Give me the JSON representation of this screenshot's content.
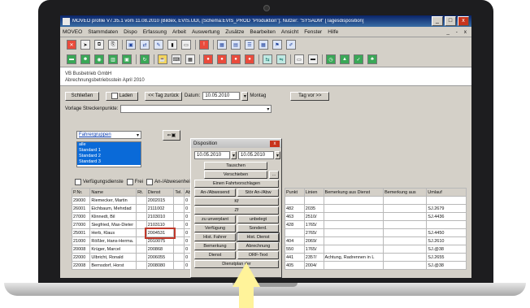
{
  "window": {
    "title": "MOVEO profile V7.35.1 vom 11.08.2010 (Bildex, EVIS.UDI, [Schema:EVIS_PROD \"Produktion\"]; Nutzer: \"SYSADM\" [Tagesdisposition]",
    "minimize": "_",
    "maximize": "□",
    "close": "x"
  },
  "menu": {
    "items": [
      "MOVEO",
      "Stammdaten",
      "Dispo",
      "Erfassung",
      "Arbeit",
      "Auswertung",
      "Zusätze",
      "Bearbeiten",
      "Ansicht",
      "Fenster",
      "Hilfe"
    ],
    "right_controls": "_ ‑ x"
  },
  "org": {
    "line1": "VB Busbetrieb GmbH",
    "line2": "Abrechnungsbetriebsstein April 2010"
  },
  "controls": {
    "close_btn": "Schließen",
    "load_btn": "Laden",
    "prev_day_btn": "<< Tag zurück",
    "date_label": "Datum:",
    "date_value": "10.05.2010",
    "weekday": "Montag",
    "next_day_btn": "Tag vor >>",
    "template_label": "Vorlage Streckenpunkte:"
  },
  "filter": {
    "dropdown": "Fahrergruppen",
    "options": [
      "alle",
      "Standard 1",
      "Standard 2",
      "Standard 3"
    ],
    "chk_verfuegung": "Verfügungsdienste",
    "chk_frei": "Frei",
    "chk_abwesend": "An-/Abwesenheit"
  },
  "table": {
    "headers": [
      "P.Nr.",
      "Name",
      "Rt.",
      "Dienst",
      "Tel.",
      "Ab"
    ],
    "rows": [
      [
        "29000",
        "Riemecker, Martin",
        "",
        "2002015",
        "",
        "0"
      ],
      [
        "26001",
        "Eichbaum, Mehrdad",
        "",
        "2111002",
        "",
        "0"
      ],
      [
        "27000",
        "Klinnedt, Bil",
        "",
        "2103010",
        "",
        "0"
      ],
      [
        "27000",
        "Siegfried, Max-Dieter",
        "",
        "2103110",
        "",
        "0"
      ],
      [
        "25001",
        "Herb, Klaus",
        "",
        "2004531",
        "",
        "0"
      ],
      [
        "21000",
        "Rößler, Hans-Herma.",
        "",
        "2010075",
        "",
        "0"
      ],
      [
        "20008",
        "Krüger, Marcel",
        "",
        "200868",
        "",
        "0"
      ],
      [
        "22000",
        "Ulbricht, Ronald",
        "",
        "2006055",
        "",
        "0"
      ],
      [
        "22008",
        "Bernsdorf, Horst",
        "",
        "2008080",
        "",
        "0"
      ]
    ]
  },
  "table_right": {
    "headers": [
      "Punkt",
      "Linien",
      "Bemerkung aus Dienst",
      "Bemerkung aus",
      "Umlauf"
    ],
    "rows": [
      [
        "",
        "",
        "",
        "",
        ""
      ],
      [
        "482",
        "2035",
        "",
        "",
        "SJ.2679"
      ],
      [
        "463",
        "2510/",
        "",
        "",
        "SJ.4436"
      ],
      [
        "428",
        "1765/",
        "",
        "",
        ""
      ],
      [
        "",
        "2765/",
        "",
        "",
        "SJ.4450"
      ],
      [
        "404",
        "2069/",
        "",
        "",
        "SJ.2610"
      ],
      [
        "550",
        "1765/",
        "",
        "",
        "SJ.@38"
      ],
      [
        "441",
        "2357/",
        "Achtung, Radrennen in L",
        "",
        "SJ.2655"
      ],
      [
        "405",
        "2004/",
        "",
        "",
        "SJ.@38"
      ]
    ]
  },
  "dialog": {
    "title": "Disposition",
    "close": "x",
    "date_from": "10.05.2010",
    "date_to": "10.05.2010",
    "btn_tauschen": "Tauschen",
    "btn_verschieben": "Verschieben",
    "btn_ellipsis": "...",
    "btn_fahrt": "Einen Fahrtvorschlagen",
    "btn_anabwesend": "An-/Abwesend",
    "btn_stoer": "Stör An-/Abw",
    "btn_kf": "Kf",
    "btn_zf": "Zf",
    "btn_zuunverplant": "zu unverplant",
    "btn_unbelegt": "unbelegt",
    "btn_verfuegung": "Verfügung",
    "btn_sonderdienst": "Sonderd.",
    "btn_hist_fahrer": "Hist. Fahrer",
    "btn_hist_dienst": "Hist. Dienst",
    "btn_bemerkung": "Bemerkung",
    "btn_abrechnung": "Abrechnung",
    "btn_dienst": "Dienst",
    "btn_orf": "ORF-Text",
    "btn_dienstplan": "Dienstplan der"
  },
  "colors": {
    "titlebar": "#0a246a",
    "selection": "#0a6ad8",
    "highlight": "#c0392b",
    "pointer": "#fff39a"
  }
}
